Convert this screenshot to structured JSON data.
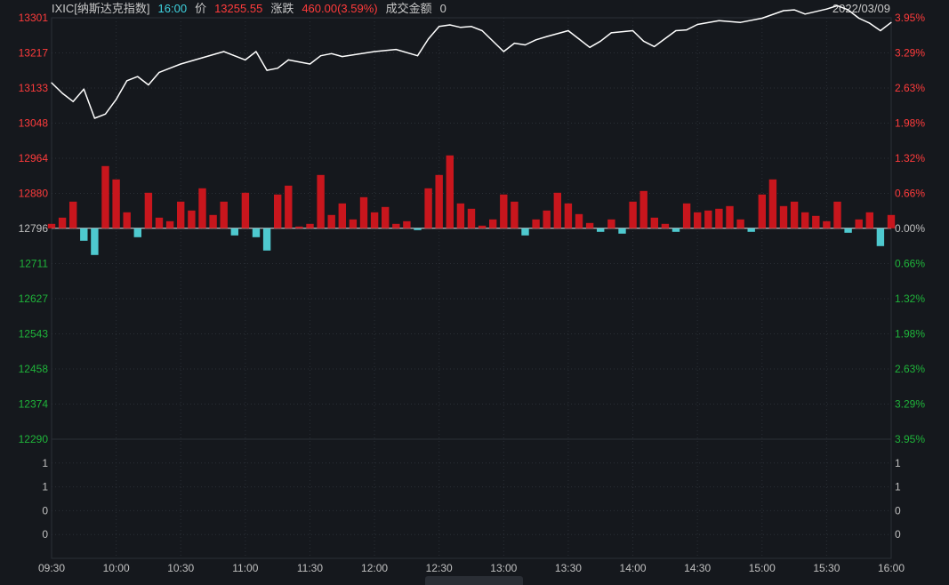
{
  "header": {
    "symbol": "IXIC[纳斯达克指数]",
    "time": "16:00",
    "price_label": "价",
    "price": "13255.55",
    "change_label": "涨跌",
    "change": "460.00(3.59%)",
    "amount_label": "成交金额",
    "amount": "0",
    "date": "2022/03/09"
  },
  "colors": {
    "background": "#15181d",
    "up": "#ff3b3b",
    "up_bar": "#c8161d",
    "down": "#1fb43a",
    "down_bar": "#4ec9cf",
    "price_line": "#ffffff",
    "grid": "#2a2f36",
    "axis_text": "#c0c0c0"
  },
  "chart_data": {
    "type": "line",
    "title": "",
    "xlabel": "",
    "ylabel": "",
    "x_ticks": [
      "09:30",
      "10:00",
      "10:30",
      "11:00",
      "11:30",
      "12:00",
      "12:30",
      "13:00",
      "13:30",
      "14:00",
      "14:30",
      "15:00",
      "15:30",
      "16:00"
    ],
    "y_ticks_left_up": [
      "13301",
      "13217",
      "13133",
      "13048",
      "12964",
      "12880"
    ],
    "y_tick_left_base": "12796",
    "y_ticks_left_down": [
      "12711",
      "12627",
      "12543",
      "12458",
      "12374",
      "12290"
    ],
    "y_ticks_right_up": [
      "3.95%",
      "3.29%",
      "2.63%",
      "1.98%",
      "1.32%",
      "0.66%"
    ],
    "y_tick_right_base": "0.00%",
    "y_ticks_right_down": [
      "0.66%",
      "1.32%",
      "1.98%",
      "2.63%",
      "3.29%",
      "3.95%"
    ],
    "ylim": [
      12290,
      13301
    ],
    "base_price": 12796,
    "lower_panel_ticks_left": [
      "1",
      "1",
      "0",
      "0"
    ],
    "lower_panel_ticks_right": [
      "1",
      "1",
      "0",
      "0"
    ],
    "series": [
      {
        "type": "line",
        "x": [
          "09:30",
          "09:35",
          "09:40",
          "09:45",
          "09:50",
          "09:55",
          "10:00",
          "10:05",
          "10:10",
          "10:15",
          "10:20",
          "10:25",
          "10:30",
          "10:40",
          "10:50",
          "11:00",
          "11:05",
          "11:10",
          "11:15",
          "11:20",
          "11:30",
          "11:35",
          "11:40",
          "11:45",
          "11:50",
          "12:00",
          "12:10",
          "12:20",
          "12:25",
          "12:30",
          "12:35",
          "12:40",
          "12:45",
          "12:50",
          "13:00",
          "13:05",
          "13:10",
          "13:15",
          "13:20",
          "13:30",
          "13:35",
          "13:40",
          "13:45",
          "13:50",
          "14:00",
          "14:05",
          "14:10",
          "14:20",
          "14:25",
          "14:30",
          "14:40",
          "14:50",
          "15:00",
          "15:10",
          "15:15",
          "15:20",
          "15:30",
          "15:35",
          "15:40",
          "15:45",
          "15:50",
          "15:55",
          "16:00"
        ],
        "values": [
          13145,
          13120,
          13100,
          13130,
          13060,
          13070,
          13105,
          13150,
          13160,
          13140,
          13170,
          13180,
          13190,
          13205,
          13220,
          13200,
          13220,
          13175,
          13180,
          13200,
          13190,
          13210,
          13215,
          13208,
          13212,
          13220,
          13225,
          13210,
          13250,
          13280,
          13284,
          13278,
          13280,
          13270,
          13220,
          13240,
          13236,
          13248,
          13256,
          13270,
          13250,
          13230,
          13245,
          13265,
          13270,
          13245,
          13232,
          13270,
          13272,
          13285,
          13294,
          13290,
          13300,
          13318,
          13320,
          13310,
          13322,
          13330,
          13320,
          13300,
          13288,
          13270,
          13290
        ]
      },
      {
        "type": "bar",
        "name": "",
        "x": [
          "09:30",
          "09:35",
          "09:40",
          "09:45",
          "09:50",
          "09:55",
          "10:00",
          "10:05",
          "10:10",
          "10:15",
          "10:20",
          "10:25",
          "10:30",
          "10:35",
          "10:40",
          "10:45",
          "10:50",
          "10:55",
          "11:00",
          "11:05",
          "11:10",
          "11:15",
          "11:20",
          "11:25",
          "11:30",
          "11:35",
          "11:40",
          "11:45",
          "11:50",
          "11:55",
          "12:00",
          "12:05",
          "12:10",
          "12:15",
          "12:20",
          "12:25",
          "12:30",
          "12:35",
          "12:40",
          "12:45",
          "12:50",
          "12:55",
          "13:00",
          "13:05",
          "13:10",
          "13:15",
          "13:20",
          "13:25",
          "13:30",
          "13:35",
          "13:40",
          "13:45",
          "13:50",
          "13:55",
          "14:00",
          "14:05",
          "14:10",
          "14:15",
          "14:20",
          "14:25",
          "14:30",
          "14:35",
          "14:40",
          "14:45",
          "14:50",
          "14:55",
          "15:00",
          "15:05",
          "15:10",
          "15:15",
          "15:20",
          "15:25",
          "15:30",
          "15:35",
          "15:40",
          "15:45",
          "15:50",
          "15:55",
          "16:00"
        ],
        "values": [
          5,
          12,
          30,
          -14,
          -30,
          70,
          55,
          18,
          -10,
          40,
          12,
          8,
          30,
          20,
          45,
          15,
          30,
          -8,
          40,
          -10,
          -25,
          38,
          48,
          2,
          5,
          60,
          15,
          28,
          10,
          35,
          18,
          24,
          5,
          8,
          -2,
          45,
          60,
          82,
          28,
          22,
          3,
          10,
          38,
          30,
          -8,
          10,
          20,
          40,
          28,
          16,
          6,
          -4,
          10,
          -6,
          30,
          42,
          12,
          5,
          -4,
          28,
          18,
          20,
          22,
          25,
          10,
          -4,
          38,
          55,
          25,
          30,
          18,
          14,
          8,
          30,
          -5,
          10,
          18,
          -20,
          15
        ]
      }
    ]
  }
}
